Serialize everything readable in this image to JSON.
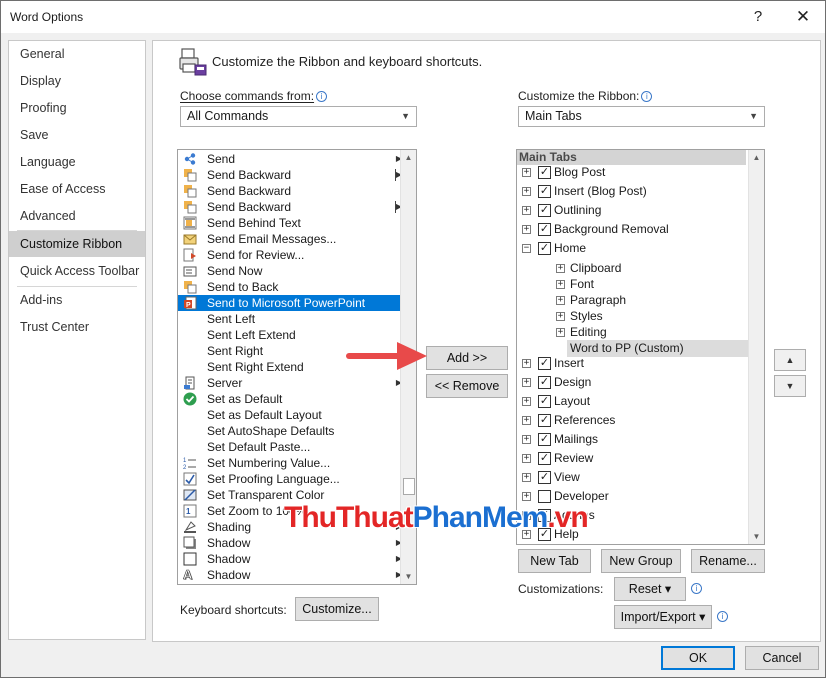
{
  "window": {
    "title": "Word Options",
    "help_glyph": "?",
    "close_glyph": "✕"
  },
  "nav": {
    "items": [
      {
        "label": "General",
        "selected": false
      },
      {
        "label": "Display",
        "selected": false
      },
      {
        "label": "Proofing",
        "selected": false
      },
      {
        "label": "Save",
        "selected": false
      },
      {
        "label": "Language",
        "selected": false
      },
      {
        "label": "Ease of Access",
        "selected": false
      },
      {
        "label": "Advanced",
        "selected": false
      },
      {
        "label": "Customize Ribbon",
        "selected": true
      },
      {
        "label": "Quick Access Toolbar",
        "selected": false
      },
      {
        "label": "Add-ins",
        "selected": false
      },
      {
        "label": "Trust Center",
        "selected": false
      }
    ]
  },
  "main": {
    "heading": "Customize the Ribbon and keyboard shortcuts.",
    "commands_label": "Choose commands from:",
    "commands_value": "All Commands",
    "ribbon_label": "Customize the Ribbon:",
    "ribbon_value": "Main Tabs",
    "info_glyph": "i"
  },
  "commands": [
    {
      "label": "Send",
      "icon": "share-icon",
      "submenu": true
    },
    {
      "label": "Send Backward",
      "icon": "send-backward-icon",
      "split": true
    },
    {
      "label": "Send Backward",
      "icon": "send-backward-icon"
    },
    {
      "label": "Send Backward",
      "icon": "send-backward-icon",
      "split": true
    },
    {
      "label": "Send Behind Text",
      "icon": "send-behind-text-icon"
    },
    {
      "label": "Send Email Messages...",
      "icon": "email-icon"
    },
    {
      "label": "Send for Review...",
      "icon": "review-icon"
    },
    {
      "label": "Send Now",
      "icon": "send-now-icon"
    },
    {
      "label": "Send to Back",
      "icon": "send-to-back-icon"
    },
    {
      "label": "Send to Microsoft PowerPoint",
      "icon": "powerpoint-icon",
      "selected": true
    },
    {
      "label": "Sent Left",
      "icon": ""
    },
    {
      "label": "Sent Left Extend",
      "icon": ""
    },
    {
      "label": "Sent Right",
      "icon": ""
    },
    {
      "label": "Sent Right Extend",
      "icon": ""
    },
    {
      "label": "Server",
      "icon": "server-icon",
      "submenu": true
    },
    {
      "label": "Set as Default",
      "icon": "checkmark-icon"
    },
    {
      "label": "Set as Default Layout",
      "icon": ""
    },
    {
      "label": "Set AutoShape Defaults",
      "icon": ""
    },
    {
      "label": "Set Default Paste...",
      "icon": ""
    },
    {
      "label": "Set Numbering Value...",
      "icon": "numbering-icon"
    },
    {
      "label": "Set Proofing Language...",
      "icon": "proofing-language-icon"
    },
    {
      "label": "Set Transparent Color",
      "icon": "transparent-color-icon"
    },
    {
      "label": "Set Zoom to 100%",
      "icon": "zoom-icon"
    },
    {
      "label": "Shading",
      "icon": "shading-icon",
      "submenu": true
    },
    {
      "label": "Shadow",
      "icon": "shadow-icon",
      "submenu": true
    },
    {
      "label": "Shadow",
      "icon": "shadow-box-icon",
      "submenu": true
    },
    {
      "label": "Shadow",
      "icon": "text-shadow-icon",
      "submenu": true
    }
  ],
  "tree": {
    "header": "Main Tabs",
    "rows": [
      {
        "label": "Blog Post",
        "level": 0,
        "expander": "+",
        "checked": true
      },
      {
        "label": "Insert (Blog Post)",
        "level": 0,
        "expander": "+",
        "checked": true
      },
      {
        "label": "Outlining",
        "level": 0,
        "expander": "+",
        "checked": true
      },
      {
        "label": "Background Removal",
        "level": 0,
        "expander": "+",
        "checked": true
      },
      {
        "label": "Home",
        "level": 0,
        "expander": "−",
        "checked": true
      },
      {
        "label": "Clipboard",
        "level": 1,
        "expander": "+"
      },
      {
        "label": "Font",
        "level": 1,
        "expander": "+"
      },
      {
        "label": "Paragraph",
        "level": 1,
        "expander": "+"
      },
      {
        "label": "Styles",
        "level": 1,
        "expander": "+"
      },
      {
        "label": "Editing",
        "level": 1,
        "expander": "+"
      },
      {
        "label": "Word to PP (Custom)",
        "level": 2,
        "selected": true
      },
      {
        "label": "Insert",
        "level": 0,
        "expander": "+",
        "checked": true
      },
      {
        "label": "Design",
        "level": 0,
        "expander": "+",
        "checked": true
      },
      {
        "label": "Layout",
        "level": 0,
        "expander": "+",
        "checked": true
      },
      {
        "label": "References",
        "level": 0,
        "expander": "+",
        "checked": true
      },
      {
        "label": "Mailings",
        "level": 0,
        "expander": "+",
        "checked": true
      },
      {
        "label": "Review",
        "level": 0,
        "expander": "+",
        "checked": true
      },
      {
        "label": "View",
        "level": 0,
        "expander": "+",
        "checked": true
      },
      {
        "label": "Developer",
        "level": 0,
        "expander": "+",
        "checked": false
      },
      {
        "label": "Add-ins",
        "level": 0,
        "expander": "+",
        "checked": true
      },
      {
        "label": "Help",
        "level": 0,
        "expander": "+",
        "checked": true
      }
    ]
  },
  "buttons": {
    "add": "Add >>",
    "remove": "<< Remove",
    "new_tab": "New Tab",
    "new_group": "New Group",
    "rename": "Rename...",
    "reset": "Reset ▾",
    "import_export": "Import/Export ▾",
    "customize": "Customize...",
    "ok": "OK",
    "cancel": "Cancel",
    "move_up": "▲",
    "move_down": "▼"
  },
  "footer": {
    "keyboard_label": "Keyboard shortcuts:",
    "customizations_label": "Customizations:"
  },
  "watermark": {
    "part1": "ThuThuat",
    "part2": "PhanMem",
    "part3": ".vn"
  },
  "colors": {
    "selection": "#0078d7",
    "arrow": "#e84a4a",
    "watermark_red": "#e32626",
    "watermark_blue": "#1b6fd1"
  }
}
